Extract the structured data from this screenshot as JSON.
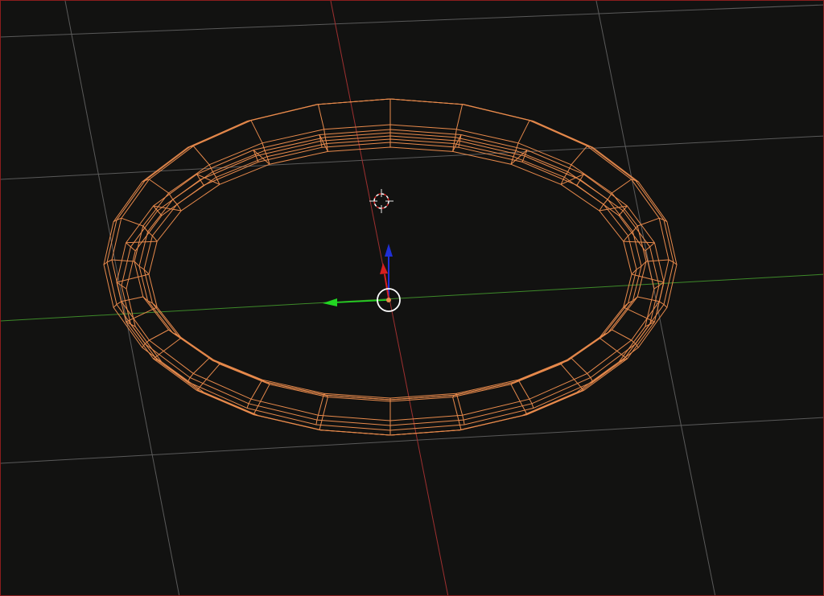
{
  "viewport": {
    "shading_mode": "wireframe",
    "border_color": "#8b1d1d"
  },
  "colors": {
    "background": "#121211",
    "grid": "#5a5a5a",
    "x_axis": "#9e3030",
    "y_axis": "#3e8a2a",
    "selection": "#e88a4c",
    "gizmo_z": "#1f2fd6",
    "gizmo_x": "#d61f1f",
    "gizmo_y": "#22d622",
    "cursor": "#ffffff"
  },
  "object": {
    "type": "torus-ring",
    "selected": true,
    "segments": 24
  },
  "icons": {
    "cursor": "3d-cursor-icon",
    "origin": "object-origin-icon",
    "gizmo": "transform-gizmo-icon"
  }
}
